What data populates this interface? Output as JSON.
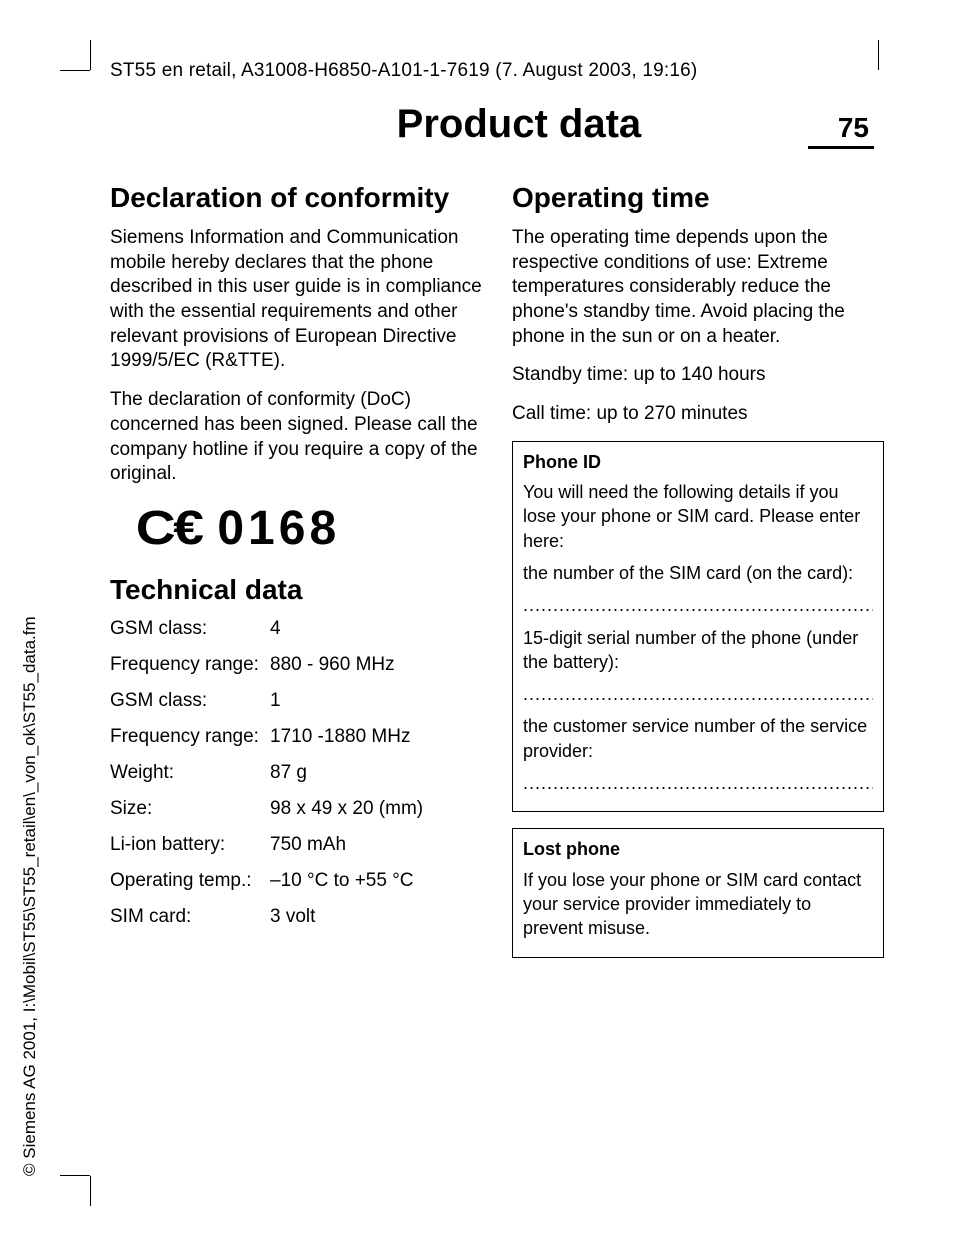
{
  "header": "ST55 en retail, A31008-H6850-A101-1-7619 (7. August 2003, 19:16)",
  "page_title": "Product data",
  "page_number": "75",
  "left": {
    "h1": "Declaration of conformity",
    "p1": "Siemens Information and Communication mobile hereby declares that the phone described in this user guide is in compliance with the essential requirements and other relevant provisions of European Directive 1999/5/EC (R&TTE).",
    "p2": "The declaration of conformity (DoC) concerned has been signed. Please call the company hotline if you require a copy of the original.",
    "ce_number": "0168",
    "h2": "Technical data",
    "tech": [
      {
        "label": "GSM class:",
        "value": "4"
      },
      {
        "label": "Frequency range:",
        "value": "880 - 960 MHz"
      },
      {
        "label": "GSM class:",
        "value": "1"
      },
      {
        "label": "Frequency range:",
        "value": "1710 -1880 MHz"
      },
      {
        "label": "Weight:",
        "value": "87 g"
      },
      {
        "label": "Size:",
        "value": "98 x 49 x 20 (mm)"
      },
      {
        "label": "Li-ion battery:",
        "value": "750 mAh"
      },
      {
        "label": "Operating temp.:",
        "value": "–10 °C to +55 °C"
      },
      {
        "label": "SIM card:",
        "value": "3 volt"
      }
    ]
  },
  "right": {
    "h1": "Operating time",
    "p1": "The operating time depends upon the respective conditions of use: Extreme temperatures considerably reduce the phone's standby time. Avoid placing the phone in the sun or on a heater.",
    "p2": "Standby time: up to 140 hours",
    "p3": "Call time: up to 270 minutes",
    "box1": {
      "title": "Phone ID",
      "p1": "You will need the following details if you lose your phone or SIM card. Please enter here:",
      "p2": "the number of the SIM card (on the card):",
      "dots1": "..............................................................",
      "p3": "15-digit serial number of the phone (under the battery):",
      "dots2": "..............................................................",
      "p4": "the customer service number of the service provider:",
      "dots3": ".............................................................."
    },
    "box2": {
      "title": "Lost phone",
      "p1": "If you lose your phone or SIM card contact your service provider immediately to prevent misuse."
    }
  },
  "side_text": "© Siemens AG 2001, I:\\Mobil\\ST55\\ST55_retail\\en\\_von_ok\\ST55_data.fm"
}
